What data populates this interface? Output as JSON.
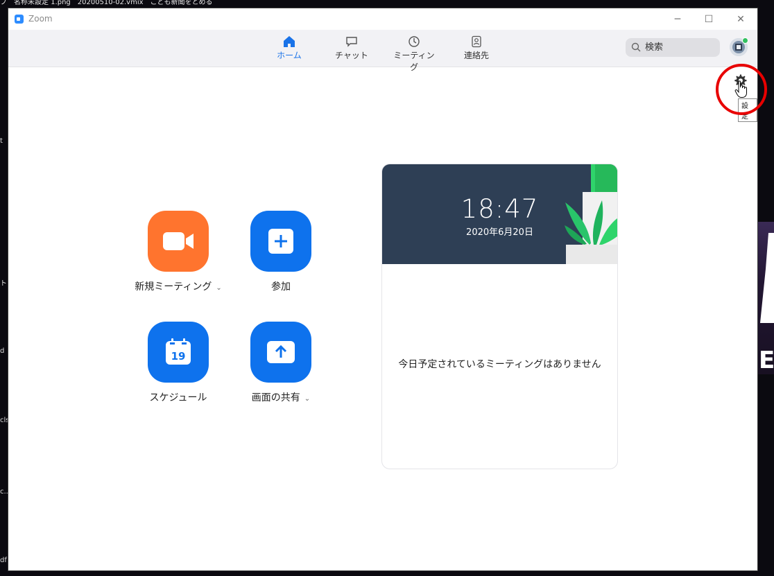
{
  "desktop": {
    "top_text": "ブ　名称未設定 1.png　20200510-02.vmix　こども新聞をとめる",
    "left_fragments": [
      "t",
      "ト.a",
      "d",
      "cls",
      "c..",
      "df"
    ]
  },
  "window": {
    "title": "Zoom",
    "controls": {
      "minimize": "─",
      "maximize": "☐",
      "close": "✕"
    }
  },
  "nav": {
    "tabs": [
      {
        "label": "ホーム",
        "icon": "home-icon",
        "active": true
      },
      {
        "label": "チャット",
        "icon": "chat-icon"
      },
      {
        "label": "ミーティング",
        "icon": "clock-icon"
      },
      {
        "label": "連絡先",
        "icon": "contact-icon"
      }
    ],
    "search_placeholder": "検索"
  },
  "settings": {
    "tooltip": "設定",
    "icon": "gear-icon"
  },
  "actions": {
    "new_meeting": {
      "label": "新規ミーティング",
      "color": "#ff742e"
    },
    "join": {
      "label": "参加",
      "color": "#0e72ed"
    },
    "schedule": {
      "label": "スケジュール",
      "calendar_day": "19",
      "color": "#0e72ed"
    },
    "share": {
      "label": "画面の共有",
      "color": "#0e72ed"
    }
  },
  "meeting_card": {
    "time": "18:47",
    "date": "2020年6月20日",
    "empty_message": "今日予定されているミーティングはありません"
  },
  "colors": {
    "accent": "#1a73e8",
    "highlight": "#e80000"
  }
}
